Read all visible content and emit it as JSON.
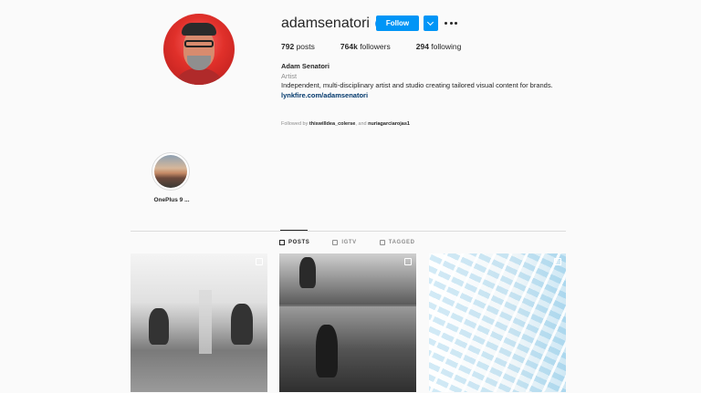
{
  "profile": {
    "username": "adamsenatori",
    "follow_label": "Follow",
    "stats": {
      "posts_value": "792",
      "posts_label": "posts",
      "followers_value": "764k",
      "followers_label": "followers",
      "following_value": "294",
      "following_label": "following"
    },
    "name": "Adam Senatori",
    "category": "Artist",
    "bio": "Independent, multi-disciplinary artist and studio creating tailored visual content for brands.",
    "link": "lynkfire.com/adamsenatori",
    "followed_by_prefix": "Followed by",
    "followed_by_1": "thiswilldea_colerse",
    "followed_by_sep": ", and",
    "followed_by_2": "nuriagarciarojas1"
  },
  "highlights": [
    {
      "label": "OnePlus 9 ..."
    }
  ],
  "tabs": [
    {
      "label": "POSTS",
      "active": true
    },
    {
      "label": "IGTV",
      "active": false
    },
    {
      "label": "TAGGED",
      "active": false
    }
  ],
  "colors": {
    "accent": "#0095f6",
    "verified": "#3897f0",
    "link": "#00376b",
    "muted": "#8e8e8e"
  }
}
